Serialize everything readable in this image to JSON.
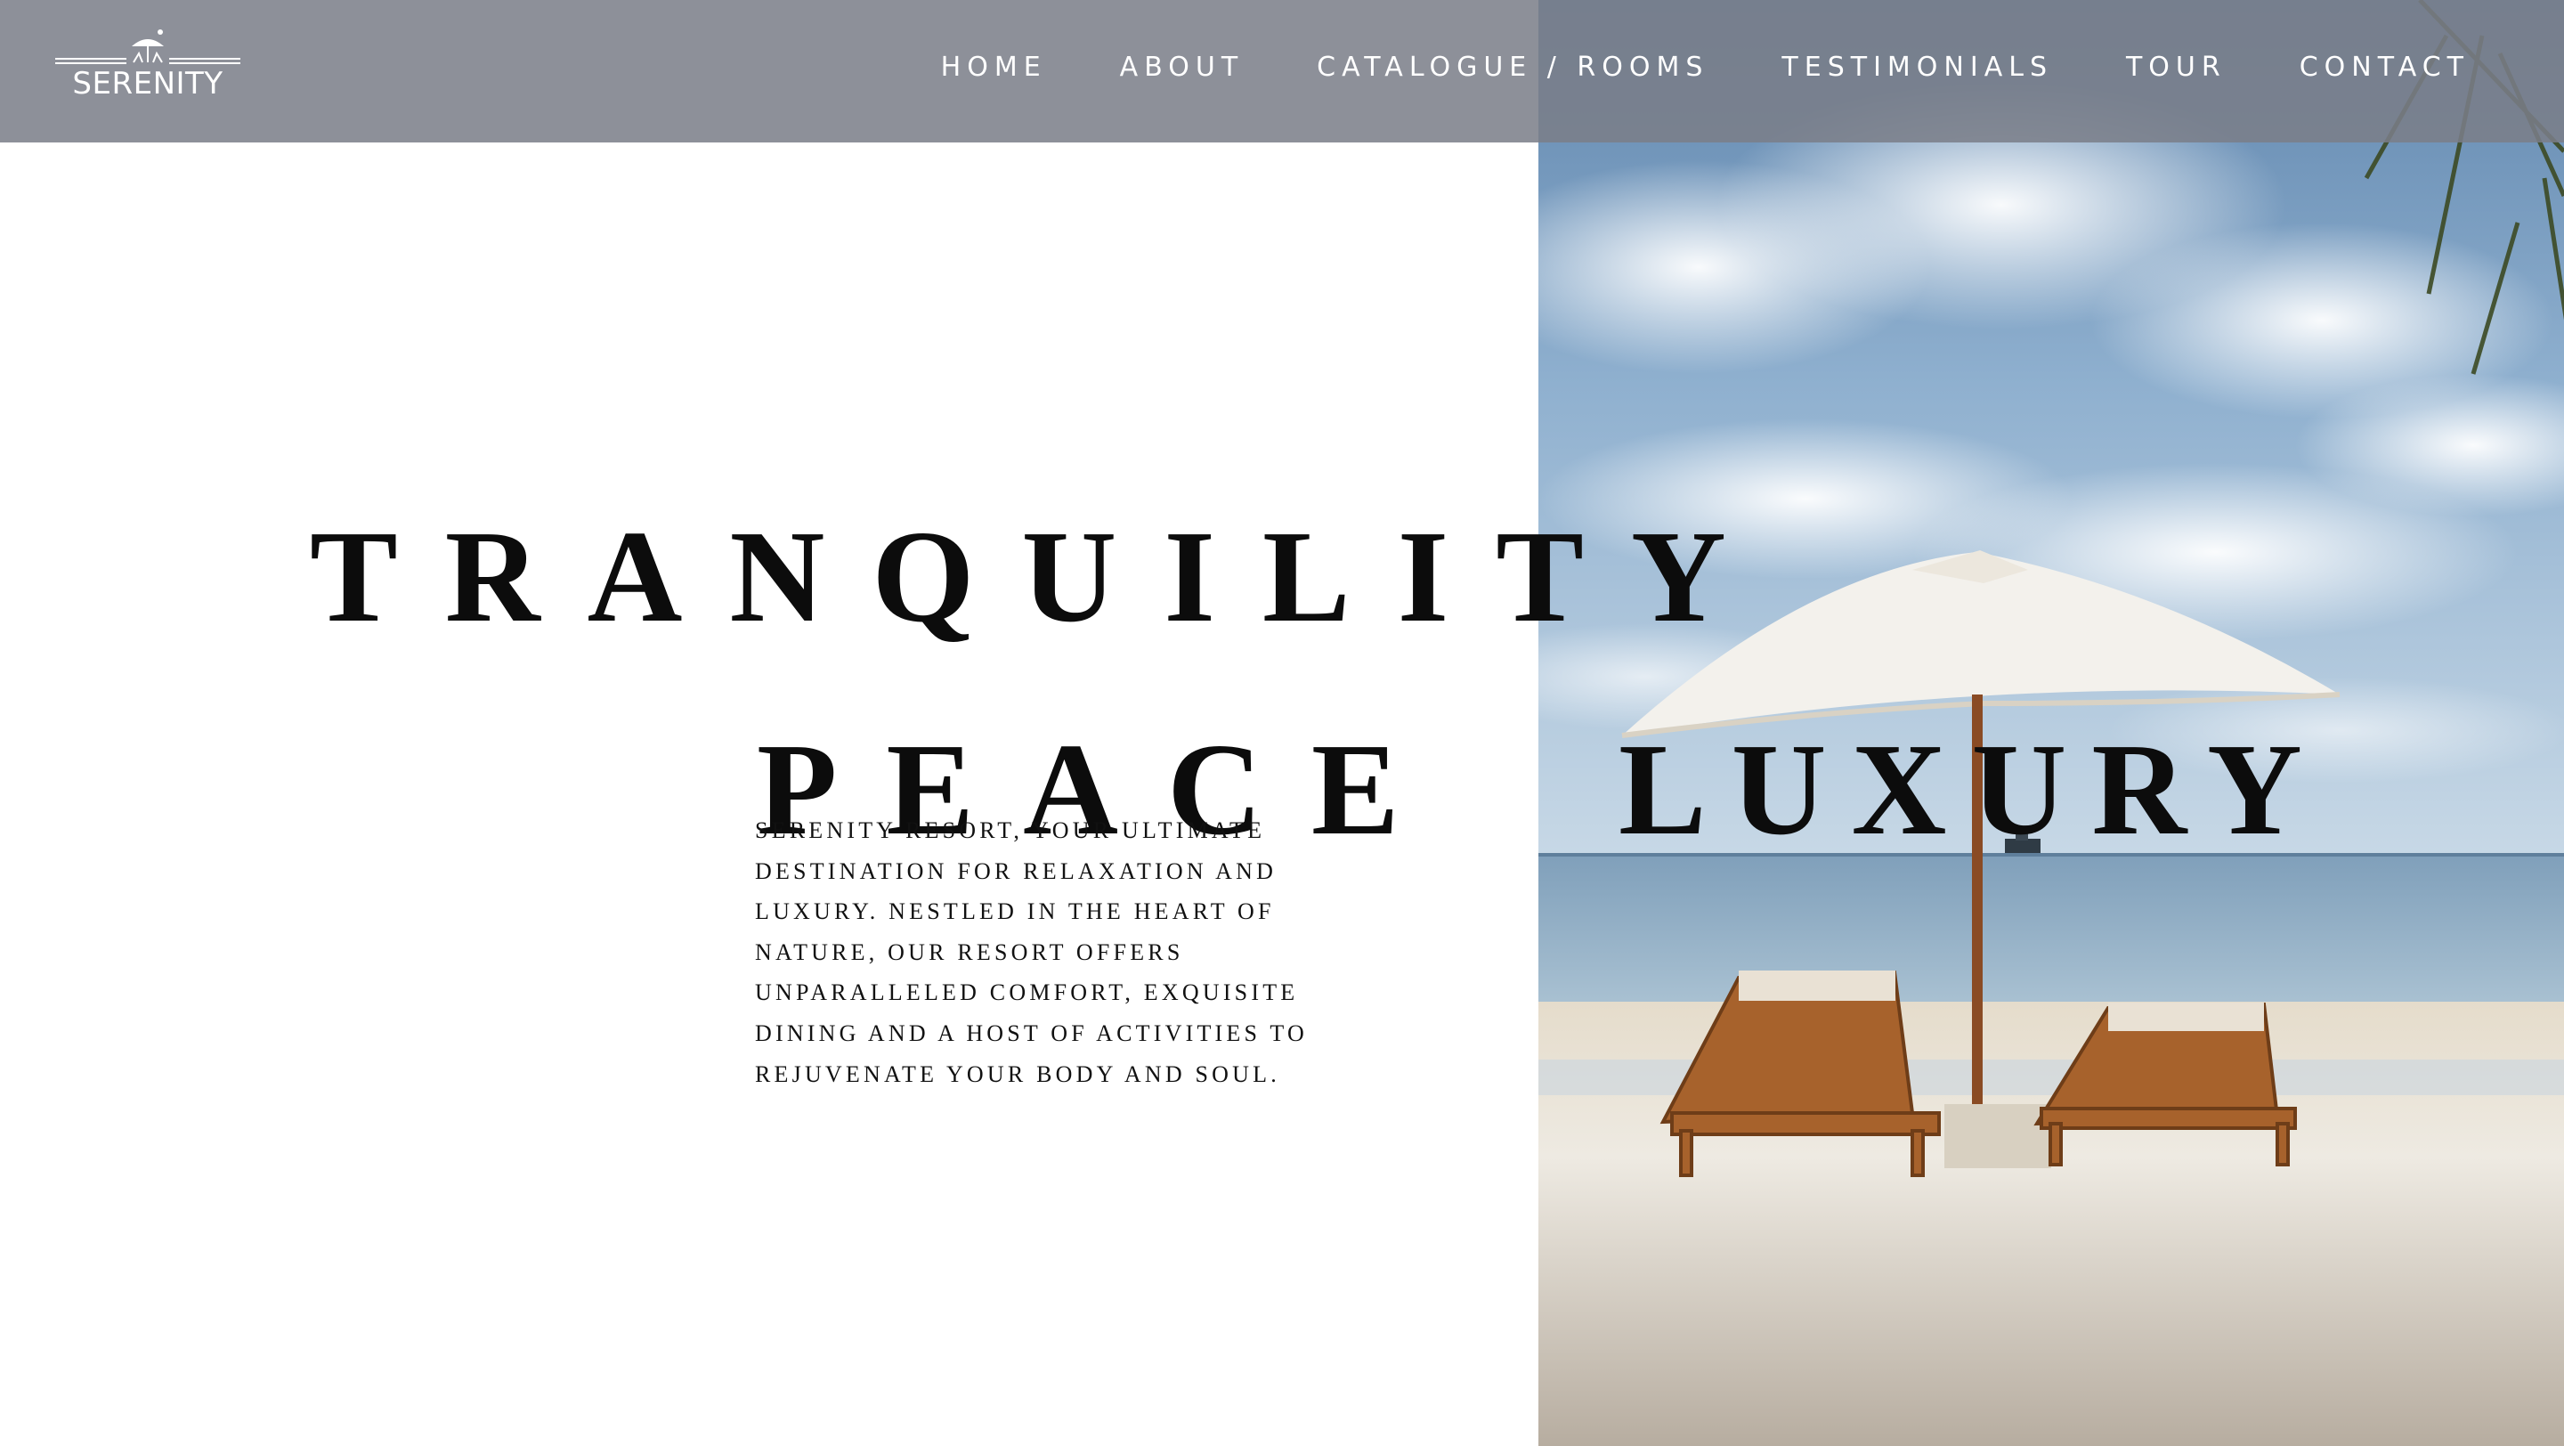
{
  "brand": {
    "name": "SERENITY"
  },
  "nav": {
    "items": [
      {
        "label": "HOME"
      },
      {
        "label": "ABOUT"
      },
      {
        "label": "CATALOGUE / ROOMS"
      },
      {
        "label": "TESTIMONIALS"
      },
      {
        "label": "TOUR"
      },
      {
        "label": "CONTACT"
      }
    ]
  },
  "hero": {
    "headline_1": "TRANQUILITY",
    "headline_2": "PEACE",
    "headline_3": "LUXURY",
    "intro": "SERENITY RESORT, YOUR ULTIMATE DESTINATION FOR RELAXATION AND LUXURY. NESTLED IN THE HEART OF NATURE, OUR RESORT OFFERS UNPARALLELED COMFORT, EXQUISITE DINING AND A HOST OF ACTIVITIES TO REJUVENATE YOUR BODY AND SOUL.",
    "image_subject": "beach-umbrella-and-sun-loungers"
  },
  "colors": {
    "nav_overlay": "#7a7e88",
    "text": "#0c0c0c",
    "background": "#ffffff"
  }
}
